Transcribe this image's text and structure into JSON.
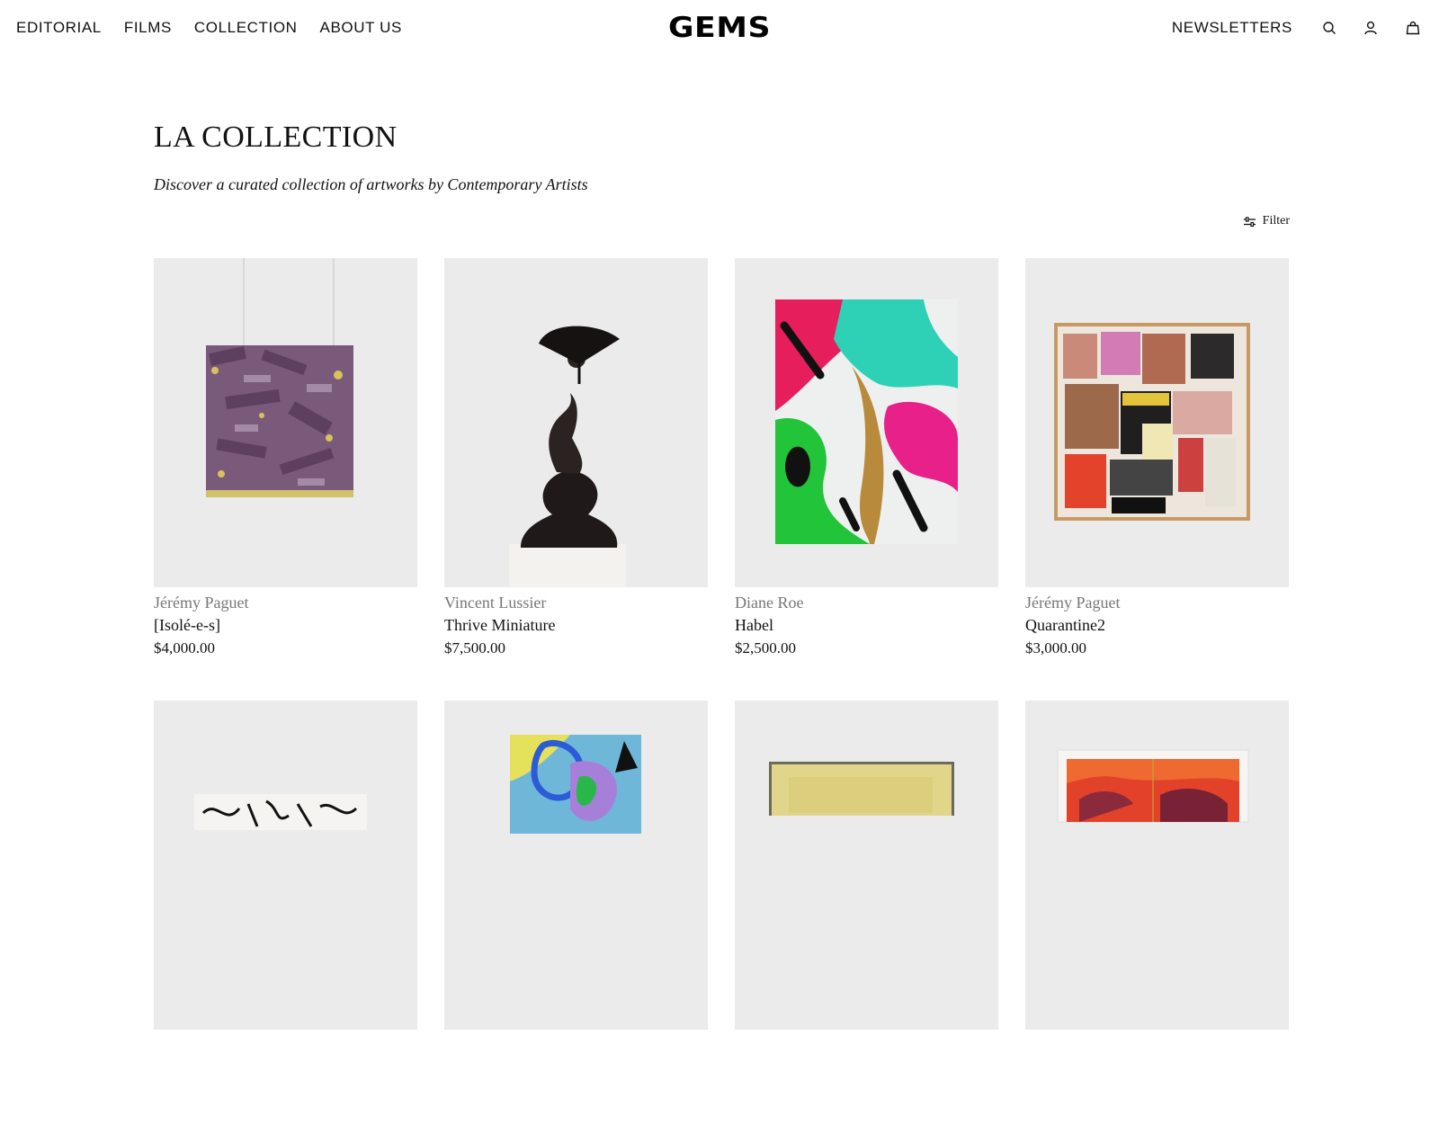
{
  "header": {
    "nav": [
      {
        "label": "EDITORIAL"
      },
      {
        "label": "FILMS"
      },
      {
        "label": "COLLECTION"
      },
      {
        "label": "ABOUT US"
      }
    ],
    "logo": "GEMS",
    "newsletters_label": "NEWSLETTERS",
    "icons": [
      "search-icon",
      "account-icon",
      "cart-icon"
    ]
  },
  "page": {
    "title": "LA COLLECTION",
    "subtitle": "Discover a curated collection of artworks by Contemporary Artists",
    "filter_label": "Filter"
  },
  "products": [
    {
      "artist": "Jérémy Paguet",
      "title": "[Isolé-e-s]",
      "price": "$4,000.00"
    },
    {
      "artist": "Vincent Lussier",
      "title": "Thrive Miniature",
      "price": "$7,500.00"
    },
    {
      "artist": "Diane Roe",
      "title": "Habel",
      "price": "$2,500.00"
    },
    {
      "artist": "Jérémy Paguet",
      "title": "Quarantine2",
      "price": "$3,000.00"
    },
    {
      "artist": "",
      "title": "",
      "price": ""
    },
    {
      "artist": "",
      "title": "",
      "price": ""
    },
    {
      "artist": "",
      "title": "",
      "price": ""
    },
    {
      "artist": "",
      "title": "",
      "price": ""
    }
  ],
  "colors": {
    "background": "#ffffff",
    "thumb_background": "#ebebeb",
    "text": "#111111",
    "artist_text": "#777777"
  }
}
